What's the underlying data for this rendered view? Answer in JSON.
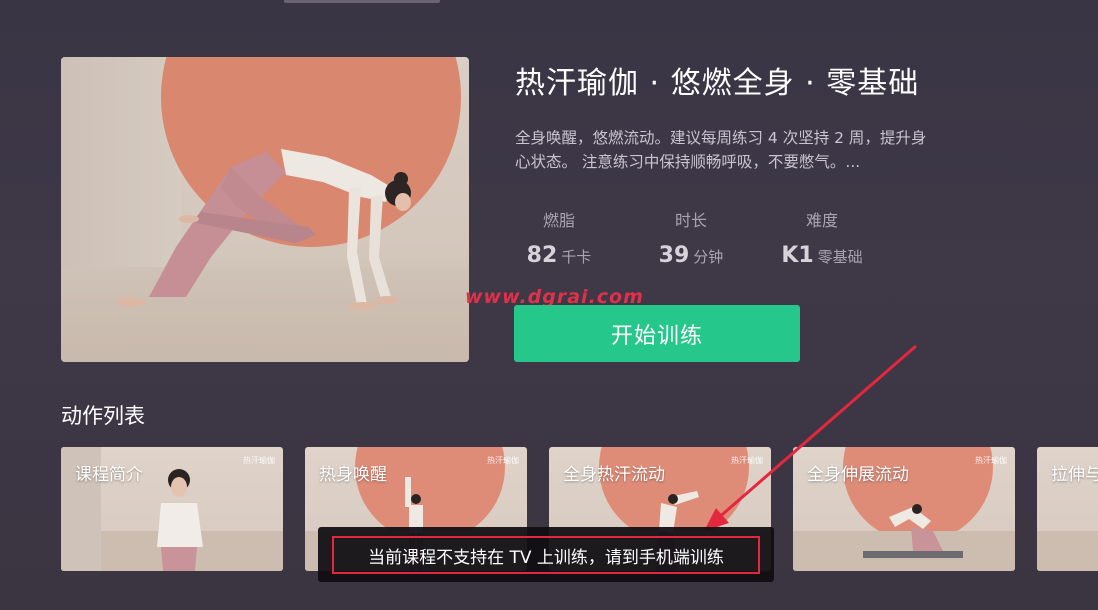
{
  "course": {
    "title": "热汗瑜伽 · 悠燃全身 · 零基础",
    "description": "全身唤醒，悠燃流动。建议每周练习 4 次坚持 2 周，提升身心状态。 注意练习中保持顺畅呼吸，不要憋气。...",
    "stats": {
      "fat": {
        "label": "燃脂",
        "value": "82",
        "unit": "千卡"
      },
      "duration": {
        "label": "时长",
        "value": "39",
        "unit": "分钟"
      },
      "difficulty": {
        "label": "难度",
        "value": "K1",
        "unit": "零基础"
      }
    },
    "start_button_label": "开始训练"
  },
  "watermark": "www.dgrai.com",
  "action_list": {
    "title": "动作列表",
    "brand_tag": "热汗瑜伽",
    "cards": [
      {
        "label": "课程简介"
      },
      {
        "label": "热身唤醒"
      },
      {
        "label": "全身热汗流动"
      },
      {
        "label": "全身伸展流动"
      },
      {
        "label": "拉伸与"
      }
    ]
  },
  "toast": {
    "message": "当前课程不支持在 TV 上训练，请到手机端训练"
  },
  "colors": {
    "background": "#3c3645",
    "accent_green": "#25c78a",
    "annotation_red": "#e3273d"
  }
}
